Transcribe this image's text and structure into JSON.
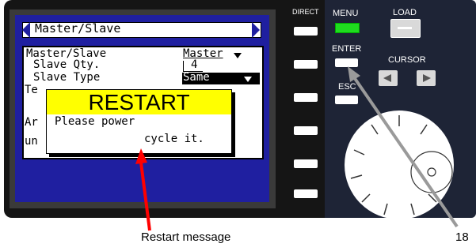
{
  "screen": {
    "title": "Master/Slave",
    "rows": [
      {
        "label": "Master/Slave",
        "value": "Master"
      },
      {
        "label": "Slave Qty.",
        "value": "4"
      },
      {
        "label": "Slave Type",
        "value": "Same"
      },
      {
        "label": "Te",
        "value": ""
      },
      {
        "label": "Ar",
        "value": ""
      },
      {
        "label": "un",
        "value": ""
      }
    ]
  },
  "popup": {
    "title": "RESTART",
    "line1": "Please power",
    "line2": "cycle it."
  },
  "panel": {
    "direct": "DIRECT",
    "menu": "MENU",
    "load": "LOAD",
    "enter": "ENTER",
    "cursor": "CURSOR",
    "esc": "ESC"
  },
  "callouts": {
    "restart_message": "Restart message",
    "number": "18"
  },
  "colors": {
    "lcd_blue": "#1f1fa0",
    "popup_yellow": "#ffff00",
    "menu_led": "#1fdc1f",
    "callout_red": "#ff0000",
    "callout_gray": "#9a9a9a"
  }
}
